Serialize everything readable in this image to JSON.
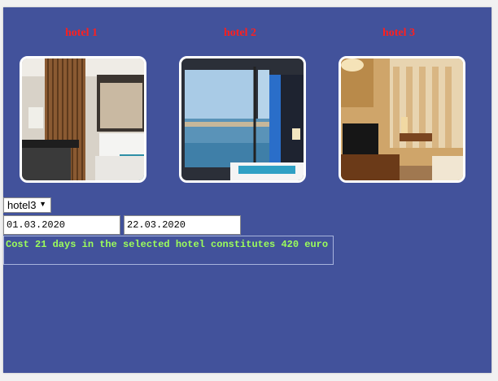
{
  "hotels": [
    {
      "title": "hotel 1",
      "image": "hotel-room-photo-1"
    },
    {
      "title": "hotel 2",
      "image": "hotel-room-photo-2"
    },
    {
      "title": "hotel 3",
      "image": "hotel-room-photo-3"
    }
  ],
  "form": {
    "hotel_select": {
      "value": "hotel3",
      "caret_icon": "dropdown-arrow-icon"
    },
    "date_from": "01.03.2020",
    "date_to": "22.03.2020",
    "result_text": "Cost 21 days in the selected hotel constitutes 420 euro"
  },
  "colors": {
    "background": "#42529b",
    "title": "#ff1f1f",
    "result_text": "#9cff5a"
  }
}
